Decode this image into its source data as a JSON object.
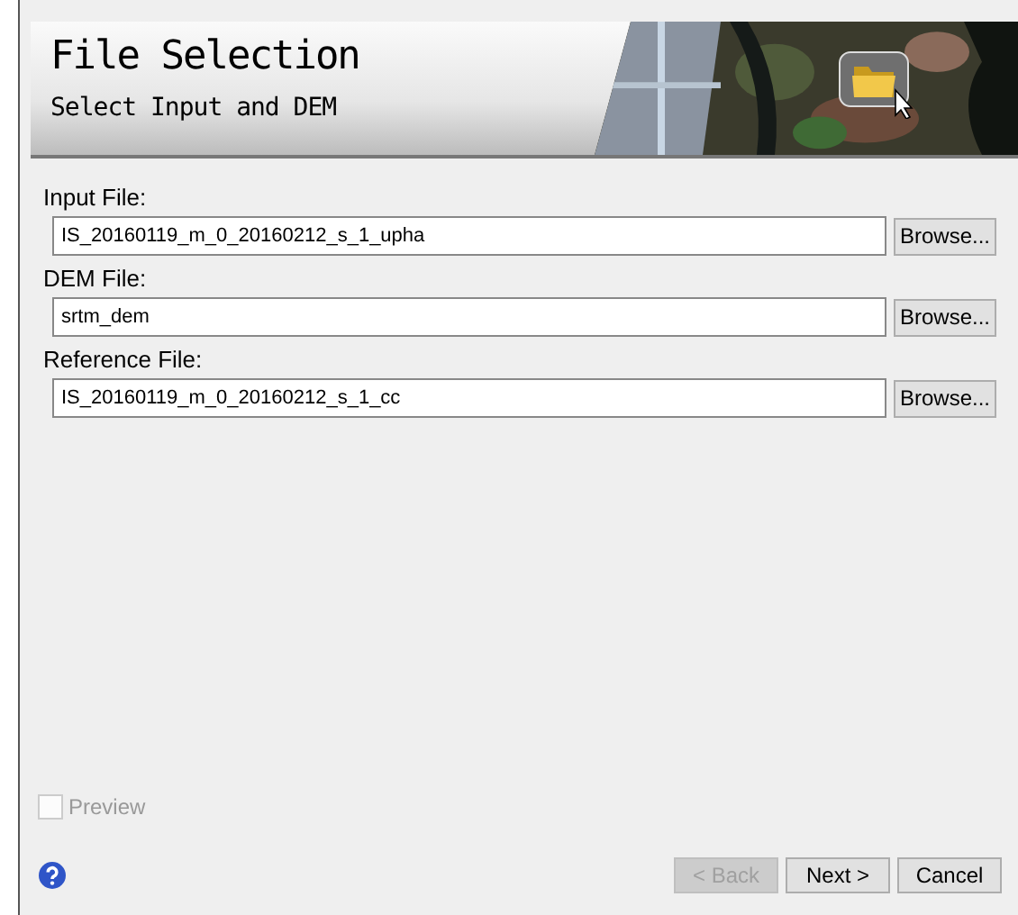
{
  "header": {
    "title": "File Selection",
    "subtitle": "Select Input and DEM"
  },
  "files": [
    {
      "label": "Input File:",
      "value": "IS_20160119_m_0_20160212_s_1_upha",
      "button": "Browse..."
    },
    {
      "label": "DEM File:",
      "value": "srtm_dem",
      "button": "Browse..."
    },
    {
      "label": "Reference File:",
      "value": "IS_20160119_m_0_20160212_s_1_cc",
      "button": "Browse..."
    }
  ],
  "preview": {
    "label": "Preview",
    "checked": false,
    "disabled": true
  },
  "buttons": [
    {
      "label": "< Back",
      "disabled": true
    },
    {
      "label": "Next >",
      "disabled": false
    },
    {
      "label": "Cancel",
      "disabled": false
    }
  ]
}
